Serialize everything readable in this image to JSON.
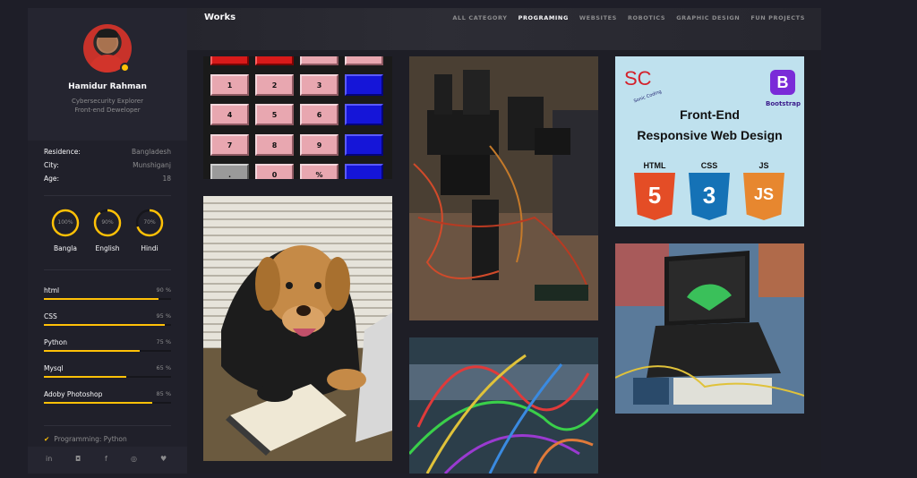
{
  "profile": {
    "name": "Hamidur Rahman",
    "role_line1": "Cybersecurity Explorer",
    "role_line2": "Front-end Deweloper"
  },
  "info": [
    {
      "key": "Residence:",
      "value": "Bangladesh"
    },
    {
      "key": "City:",
      "value": "Munshiganj"
    },
    {
      "key": "Age:",
      "value": "18"
    }
  ],
  "languages": [
    {
      "label": "Bangla",
      "pct": "100%",
      "value": 100
    },
    {
      "label": "English",
      "pct": "90%",
      "value": 90
    },
    {
      "label": "Hindi",
      "pct": "70%",
      "value": 70
    }
  ],
  "skills": [
    {
      "name": "html",
      "pct": "90 %",
      "value": 90
    },
    {
      "name": "CSS",
      "pct": "95 %",
      "value": 95
    },
    {
      "name": "Python",
      "pct": "75 %",
      "value": 75
    },
    {
      "name": "Mysql",
      "pct": "65 %",
      "value": 65
    },
    {
      "name": "Adoby Photoshop",
      "pct": "85 %",
      "value": 85
    }
  ],
  "knowledge": {
    "item1": "Programming: Python"
  },
  "social": {
    "icons": [
      "linkedin-icon",
      "instagram-icon",
      "facebook-icon",
      "github-icon",
      "twitter-icon"
    ],
    "labels": [
      "in",
      "◘",
      "f",
      "◎",
      "♥"
    ]
  },
  "works": {
    "title": "Works",
    "nav": [
      "ALL CATEGORY",
      "PROGRAMING",
      "WEBSITES",
      "ROBOTICS",
      "GRAPHIC DESIGN",
      "FUN PROJECTS"
    ]
  },
  "calculator": {
    "row1": [
      "1",
      "2",
      "3",
      ""
    ],
    "row2": [
      "4",
      "5",
      "6",
      ""
    ],
    "row3": [
      "7",
      "8",
      "9",
      ""
    ],
    "row4": [
      ".",
      "0",
      "%",
      ""
    ]
  },
  "frontend_card": {
    "logo": "SC",
    "logo_sub": "Sonic Coding",
    "bootstrap_letter": "B",
    "bootstrap_label": "Bootstrap",
    "title1": "Front-End",
    "title2": "Responsive Web Design",
    "langs": [
      {
        "label": "HTML",
        "num": "5",
        "color": "#e44d26"
      },
      {
        "label": "CSS",
        "num": "3",
        "color": "#1572b6"
      },
      {
        "label": "JS",
        "num": "JS",
        "color": "#e7872f"
      }
    ]
  },
  "colors": {
    "accent": "#ffc107",
    "sidebar": "#20202a",
    "background": "#1e1e28"
  }
}
